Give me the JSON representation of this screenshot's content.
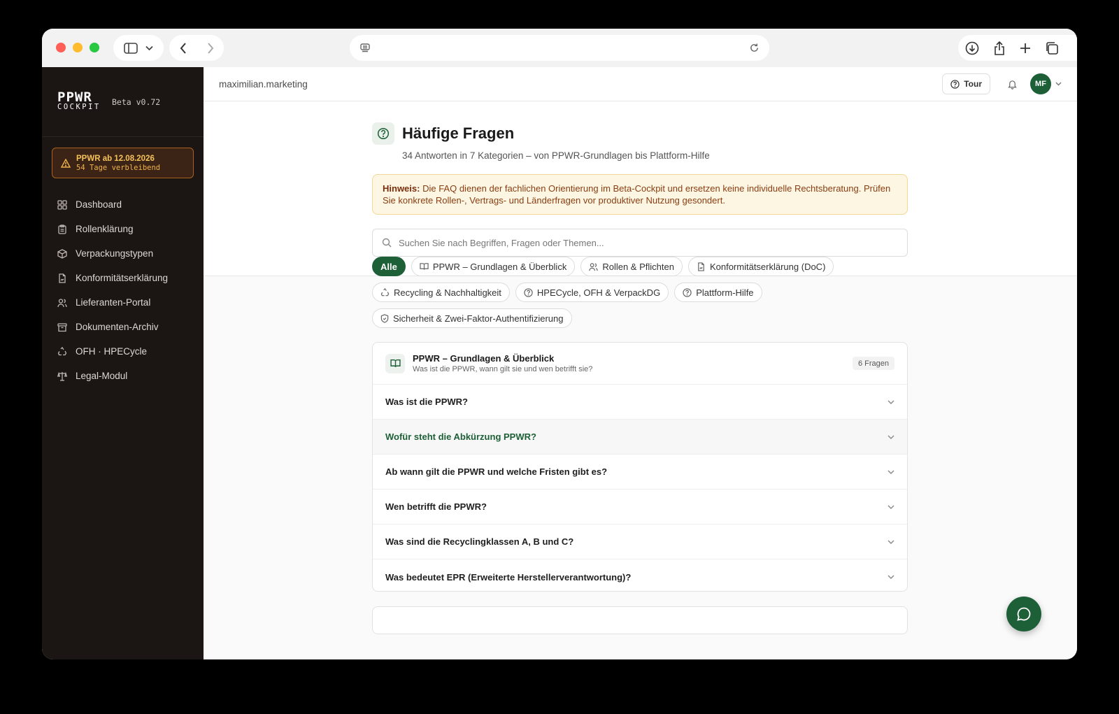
{
  "sidebar": {
    "logo_line1": "PPWR",
    "logo_line2": "COCKPIT",
    "version": "Beta v0.72",
    "deadline_title": "PPWR ab 12.08.2026",
    "deadline_days": "54 Tage verbleibend",
    "items": [
      {
        "label": "Dashboard",
        "icon": "dashboard-icon"
      },
      {
        "label": "Rollenklärung",
        "icon": "clipboard-icon"
      },
      {
        "label": "Verpackungstypen",
        "icon": "package-icon"
      },
      {
        "label": "Konformitätserklärung",
        "icon": "file-sign-icon"
      },
      {
        "label": "Lieferanten-Portal",
        "icon": "users-icon"
      },
      {
        "label": "Dokumenten-Archiv",
        "icon": "archive-icon"
      },
      {
        "label": "OFH · HPECycle",
        "icon": "recycle-icon"
      },
      {
        "label": "Legal-Modul",
        "icon": "scale-icon"
      }
    ]
  },
  "topbar": {
    "workspace": "maximilian.marketing",
    "tour_label": "Tour",
    "avatar_initials": "MF"
  },
  "page": {
    "title": "Häufige Fragen",
    "subtitle": "34 Antworten in 7 Kategorien – von PPWR-Grundlagen bis Plattform-Hilfe",
    "notice_label": "Hinweis:",
    "notice_text": "Die FAQ dienen der fachlichen Orientierung im Beta-Cockpit und ersetzen keine individuelle Rechtsberatung. Prüfen Sie konkrete Rollen-, Vertrags- und Länderfragen vor produktiver Nutzung gesondert.",
    "search_placeholder": "Suchen Sie nach Begriffen, Fragen oder Themen..."
  },
  "filters": [
    {
      "label": "Alle",
      "active": true
    },
    {
      "label": "PPWR – Grundlagen & Überblick",
      "icon": "book-icon"
    },
    {
      "label": "Rollen & Pflichten",
      "icon": "users-icon"
    },
    {
      "label": "Konformitätserklärung (DoC)",
      "icon": "file-sign-icon"
    },
    {
      "label": "Recycling & Nachhaltigkeit",
      "icon": "recycle-icon"
    },
    {
      "label": "HPECycle, OFH & VerpackDG",
      "icon": "help-circle-icon"
    },
    {
      "label": "Plattform-Hilfe",
      "icon": "help-circle-icon"
    },
    {
      "label": "Sicherheit & Zwei-Faktor-Authentifizierung",
      "icon": "shield-icon"
    }
  ],
  "faq_section": {
    "title": "PPWR – Grundlagen & Überblick",
    "subtitle": "Was ist die PPWR, wann gilt sie und wen betrifft sie?",
    "count": "6 Fragen",
    "questions": [
      "Was ist die PPWR?",
      "Wofür steht die Abkürzung PPWR?",
      "Ab wann gilt die PPWR und welche Fristen gibt es?",
      "Wen betrifft die PPWR?",
      "Was sind die Recyclingklassen A, B und C?",
      "Was bedeutet EPR (Erweiterte Herstellerverantwortung)?"
    ]
  },
  "colors": {
    "brand": "#1d5f37",
    "sidebar_bg": "#1b1513",
    "notice_bg": "#fdf6e3"
  }
}
